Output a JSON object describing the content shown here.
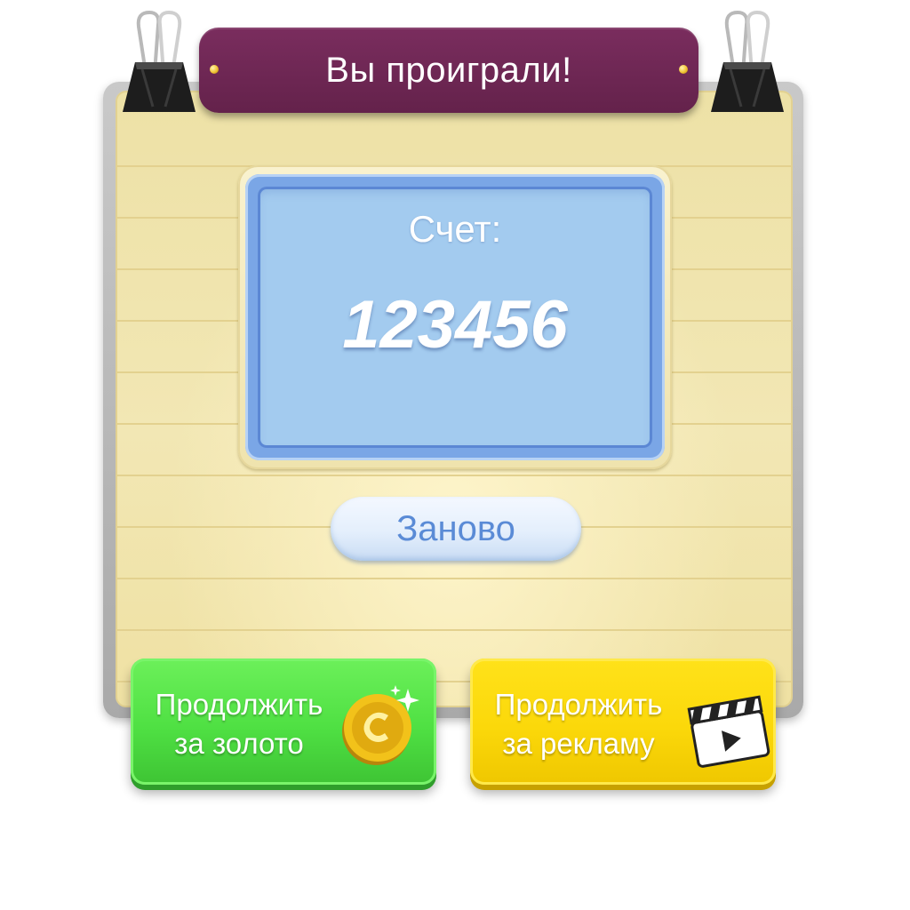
{
  "dialog": {
    "title": "Вы проиграли!"
  },
  "score": {
    "label": "Счет:",
    "value": "123456"
  },
  "buttons": {
    "restart_label": "Заново",
    "continue_gold": {
      "line1": "Продолжить",
      "line2": "за золото",
      "icon": "gold-coin-icon"
    },
    "continue_ad": {
      "line1": "Продолжить",
      "line2": "за рекламу",
      "icon": "clapperboard-play-icon"
    }
  },
  "colors": {
    "title_banner": "#6b2550",
    "score_panel": "#a3cbef",
    "gold_button": "#4fe043",
    "ad_button": "#fbd80a",
    "restart_text": "#5a8bd6"
  }
}
